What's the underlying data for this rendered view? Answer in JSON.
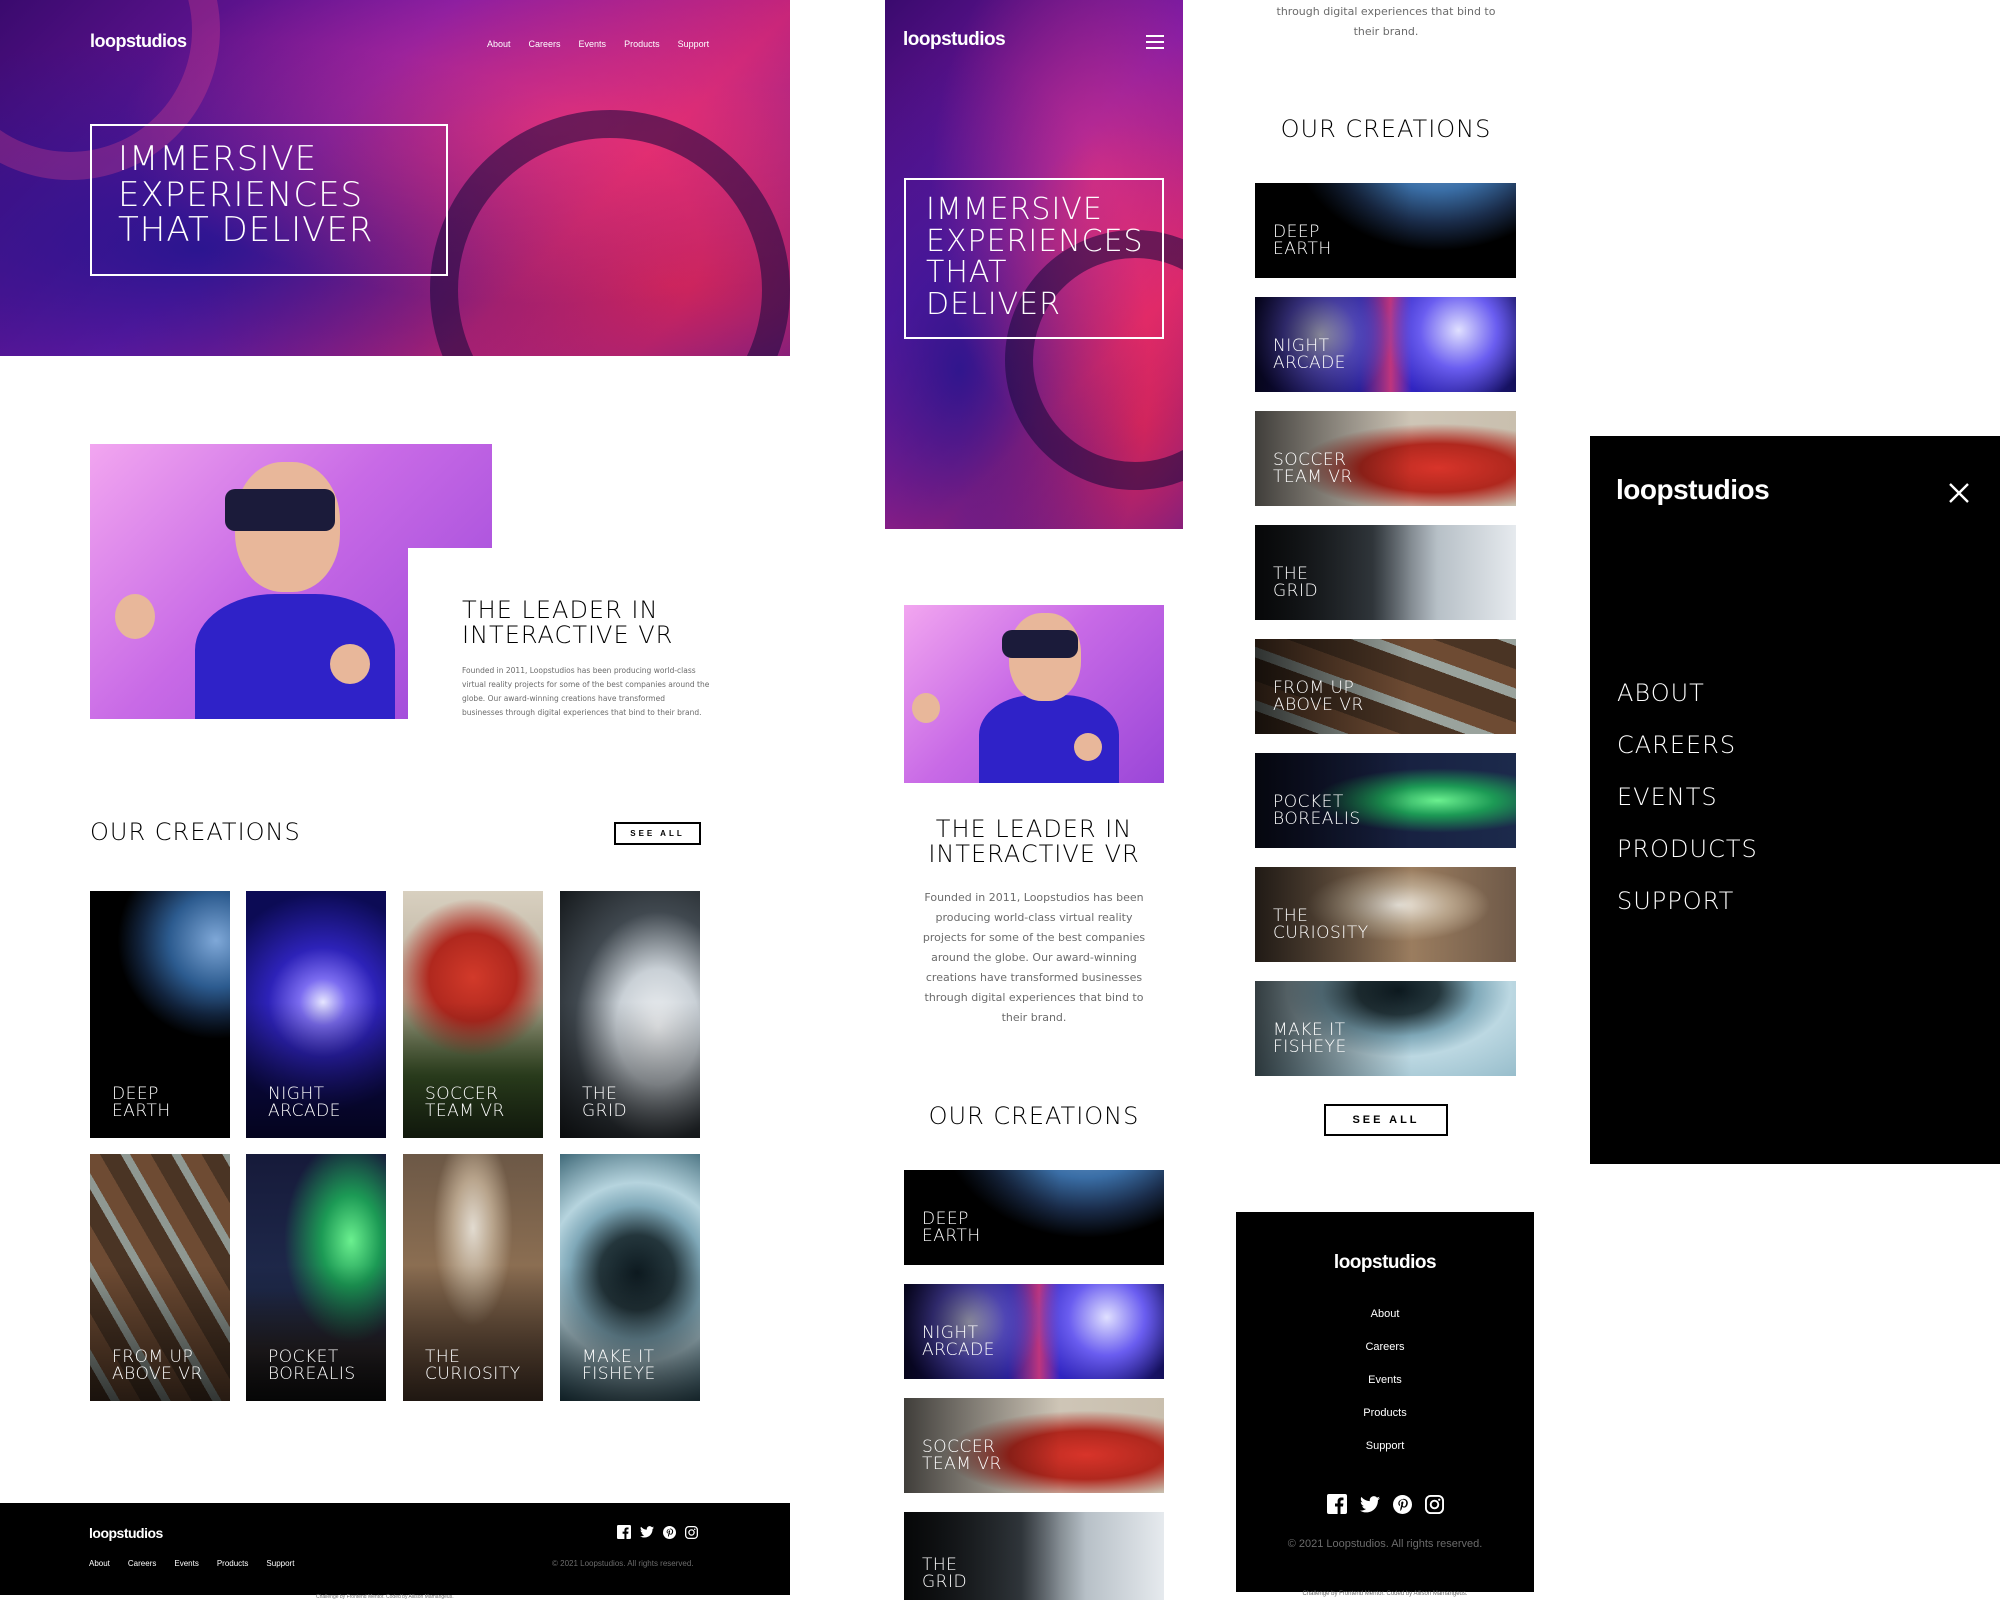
{
  "brand": "loopstudios",
  "nav": [
    "About",
    "Careers",
    "Events",
    "Products",
    "Support"
  ],
  "menu_items": [
    "ABOUT",
    "CAREERS",
    "EVENTS",
    "PRODUCTS",
    "SUPPORT"
  ],
  "hero": {
    "line1": "IMMERSIVE",
    "line2": "EXPERIENCES",
    "line3": "THAT DELIVER",
    "line3a": "THAT",
    "line3b": "DELIVER"
  },
  "leader": {
    "title1": "THE LEADER IN",
    "title2": "INTERACTIVE VR",
    "desktop_lines": [
      "Founded in 2011, Loopstudios has been producing world-class",
      "virtual reality projects for some of the best companies around the",
      "globe. Our award-winning creations have transformed",
      "businesses through digital experiences that bind to their brand."
    ],
    "mobile_lines": [
      "Founded in 2011, Loopstudios has been",
      "producing world-class virtual reality",
      "projects for some of the best companies",
      "around the globe. Our award-winning",
      "creations have transformed businesses",
      "through digital experiences that bind to",
      "their brand."
    ],
    "cut_lines": [
      "through digital experiences that bind to",
      "their brand."
    ]
  },
  "creations": {
    "title": "OUR CREATIONS",
    "see_all": "SEE ALL",
    "items": [
      {
        "l1": "DEEP",
        "l2": "EARTH"
      },
      {
        "l1": "NIGHT",
        "l2": "ARCADE"
      },
      {
        "l1": "SOCCER",
        "l2": "TEAM VR"
      },
      {
        "l1": "THE",
        "l2": "GRID"
      },
      {
        "l1": "FROM UP",
        "l2": "ABOVE VR"
      },
      {
        "l1": "POCKET",
        "l2": "BOREALIS"
      },
      {
        "l1": "THE",
        "l2": "CURIOSITY"
      },
      {
        "l1": "MAKE IT",
        "l2": "FISHEYE"
      }
    ]
  },
  "footer": {
    "copyright": "© 2021 Loopstudios. All rights reserved.",
    "credit": "Challenge by Frontend Mentor. Coded by Allison Mamangeus."
  },
  "icons": [
    "facebook-icon",
    "twitter-icon",
    "pinterest-icon",
    "instagram-icon",
    "hamburger-icon",
    "close-icon"
  ],
  "colors": {
    "background": "#ffffff",
    "dark": "#000000",
    "text_gray": "#6b6b6b",
    "accent_purple": "#7a1aa8"
  }
}
